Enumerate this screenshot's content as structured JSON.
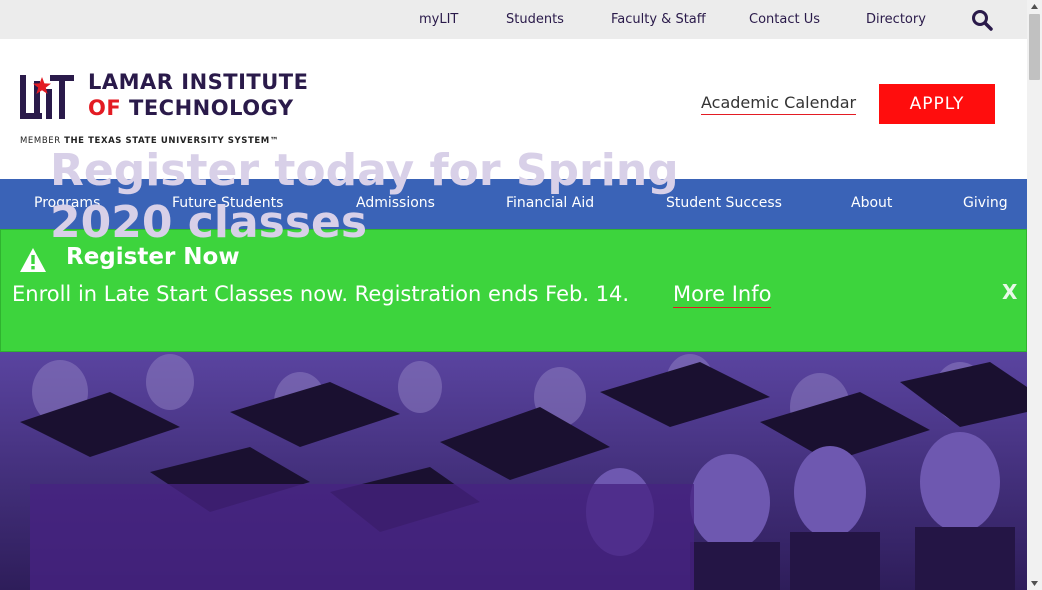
{
  "utility_nav": {
    "links": [
      "myLIT",
      "Students",
      "Faculty & Staff",
      "Contact Us",
      "Directory"
    ],
    "search_icon": "search-icon"
  },
  "header": {
    "logo": {
      "line1": "LAMAR INSTITUTE",
      "line2_of": "OF",
      "line2_tech": "TECHNOLOGY",
      "member_prefix": "MEMBER",
      "member_system": "THE TEXAS STATE UNIVERSITY SYSTEM™"
    },
    "academic_calendar": "Academic Calendar",
    "apply": "APPLY"
  },
  "main_nav": {
    "items": [
      "Programs",
      "Future Students",
      "Admissions",
      "Financial Aid",
      "Student Success",
      "About",
      "Giving"
    ]
  },
  "alert": {
    "icon": "warning-icon",
    "title": "Register Now",
    "text": "Enroll in Late Start Classes now. Registration ends Feb. 14.",
    "link": "More Info",
    "close": "X"
  },
  "hero": {
    "headline": "Register today for Spring 2020 classes"
  },
  "colors": {
    "brand_purple": "#2a1a4a",
    "brand_red": "#e31b23",
    "apply_red": "#ff0d0d",
    "nav_blue": "#3a63b7",
    "alert_green": "#3dd43d",
    "hero_purple": "#3e2a6e"
  }
}
